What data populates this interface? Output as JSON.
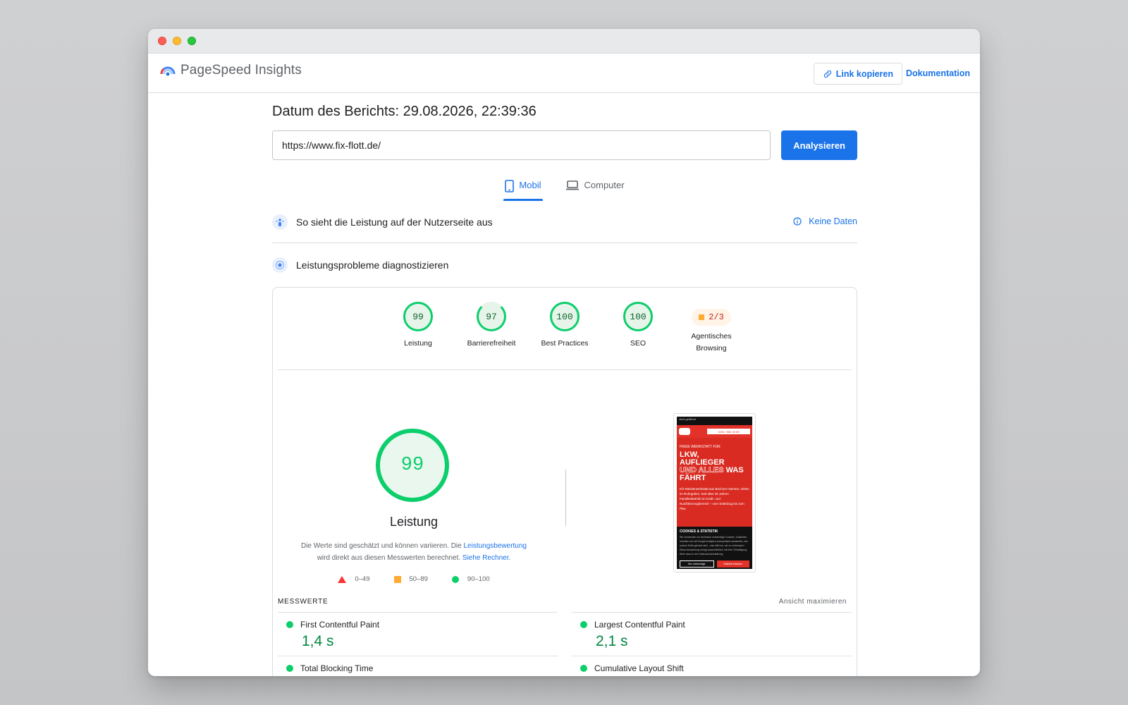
{
  "app": {
    "name": "PageSpeed Insights",
    "copy_link": "Link kopieren",
    "docs": "Dokumentation"
  },
  "report": {
    "date_label": "Datum des Berichts: 29.08.2026, 22:39:36",
    "url": "https://www.fix-flott.de/",
    "analyze": "Analysieren"
  },
  "tabs": [
    {
      "label": "Mobil",
      "icon": "smartphone-icon",
      "active": true
    },
    {
      "label": "Computer",
      "icon": "laptop-icon",
      "active": false
    }
  ],
  "field_data": {
    "title": "So sieht die Leistung auf der Nutzerseite aus",
    "no_data": "Keine Daten"
  },
  "diagnose": {
    "title": "Leistungsprobleme diagnostizieren"
  },
  "scores": [
    {
      "value": "99",
      "label": "Leistung",
      "fraction": 0.99
    },
    {
      "value": "97",
      "label": "Barrierefreiheit",
      "fraction": 0.97
    },
    {
      "value": "100",
      "label": "Best Practices",
      "fraction": 1.0
    },
    {
      "value": "100",
      "label": "SEO",
      "fraction": 1.0
    }
  ],
  "agentic": {
    "value": "2/3",
    "label_line1": "Agentisches",
    "label_line2": "Browsing"
  },
  "performance": {
    "score": "99",
    "title": "Leistung",
    "desc_part1": "Die Werte sind geschätzt und können variieren. Die",
    "desc_link1": "Leistungsbewertung",
    "desc_part2": "wird direkt aus diesen Messwerten berechnet.",
    "desc_link2": "Siehe Rechner."
  },
  "legend": [
    {
      "range": "0–49",
      "shape": "triangle",
      "color": "#ff3333"
    },
    {
      "range": "50–89",
      "shape": "square",
      "color": "#ffaa33"
    },
    {
      "range": "90–100",
      "shape": "circle",
      "color": "#0cce6b"
    }
  ],
  "screenshot": {
    "top_bar": "Jetzt geöffnet",
    "top_bar2": "heute 8:00-22:00 Uhr",
    "phone_box": "0234 / 584 49 85",
    "kicker": "FREIE WERKSTATT FÜR",
    "headline1": "LKW,",
    "headline2": "AUFLIEGER",
    "headline3a": "UND ALLES",
    "headline3b": "WAS",
    "headline4": "FÄHRT",
    "body": "Kfz-Meisterwerkstatt aus Bochum Hamme, mitten im Ruhrgebiet. Seit über 20 Jahren Familienbetrieb im Kraft- und Nutzfahrzeugbereich – vom Sattelzug bis zum Pkw.",
    "cookie_title": "COOKIES & STATISTIK",
    "cookie_text": "Wir verwenden nur technisch notwendige Cookies. Zusätzlich möchten wir mit Google Analytics anonymisiert auswerten, wie unsere Seite genutzt wird – das hilft uns, sie zu verbessern. Diese Auswertung erfolgt ausschließlich mit Ihrer Einwilligung. Mehr dazu in der Datenschutzerklärung.",
    "btn_necessary": "Nur notwendige",
    "btn_allow": "Statistik erlauben"
  },
  "metrics": {
    "title": "MESSWERTE",
    "maximize": "Ansicht maximieren",
    "items": [
      {
        "name": "First Contentful Paint",
        "value": "1,4 s"
      },
      {
        "name": "Largest Contentful Paint",
        "value": "2,1 s"
      },
      {
        "name": "Total Blocking Time",
        "value": ""
      },
      {
        "name": "Cumulative Layout Shift",
        "value": ""
      }
    ]
  }
}
